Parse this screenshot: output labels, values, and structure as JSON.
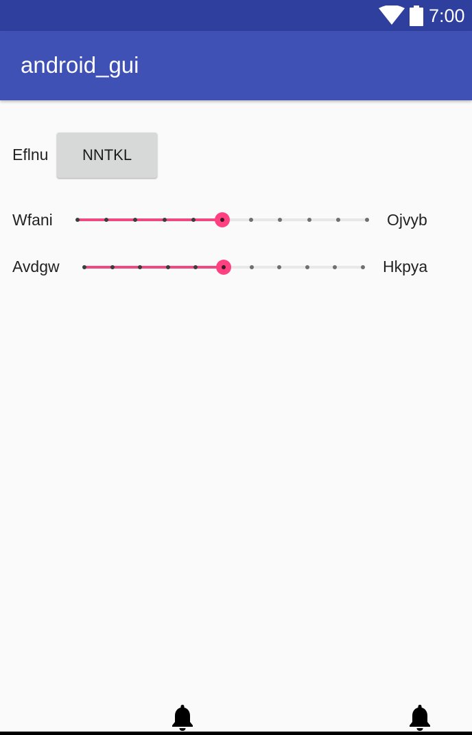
{
  "status_bar": {
    "time": "7:00",
    "icons": [
      "wifi-icon",
      "battery-icon"
    ]
  },
  "app_bar": {
    "title": "android_gui"
  },
  "main": {
    "row1": {
      "label": "Eflnu",
      "button_label": "NNTKL"
    },
    "slider1": {
      "left_label": "Wfani",
      "right_label": "Ojvyb",
      "steps": 10,
      "value": 5
    },
    "slider2": {
      "left_label": "Avdgw",
      "right_label": "Hkpya",
      "steps": 10,
      "value": 5
    }
  },
  "bottom_bar": {
    "icons": [
      "bell-icon",
      "bell-icon"
    ]
  },
  "colors": {
    "status_bar": "#2f3f9e",
    "app_bar": "#3f51b5",
    "accent": "#ff4081",
    "background": "#fafafa"
  }
}
